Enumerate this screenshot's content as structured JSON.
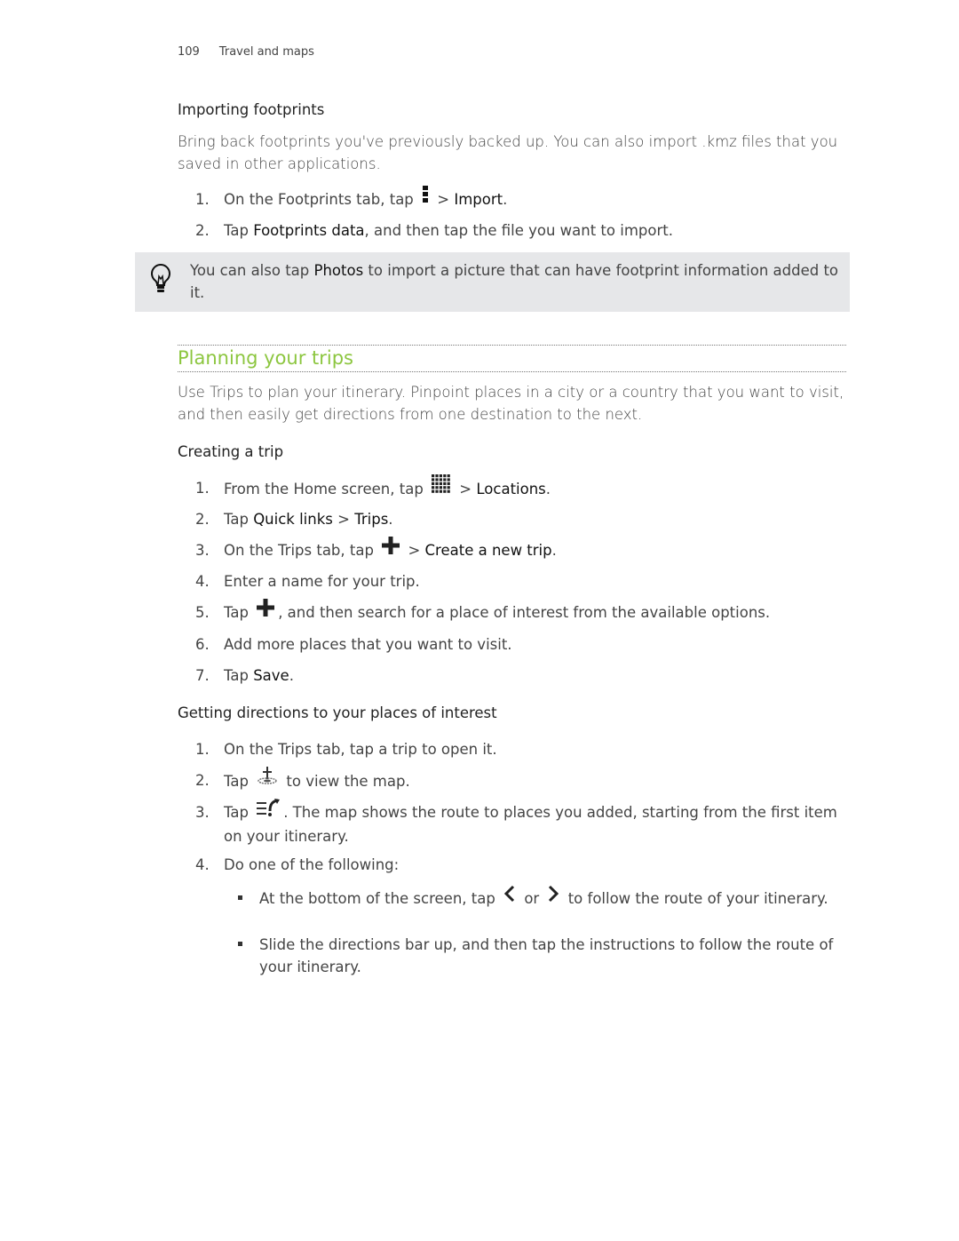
{
  "header": {
    "page_number": "109",
    "chapter": "Travel and maps"
  },
  "importing": {
    "title": "Importing footprints",
    "intro": "Bring back footprints you've previously backed up. You can also import .kmz files that you saved in other applications.",
    "steps": [
      [
        {
          "t": "On the Footprints tab, tap "
        },
        {
          "i": "menu-icon"
        },
        {
          "t": " > "
        },
        {
          "b": "Import"
        },
        {
          "t": "."
        }
      ],
      [
        {
          "t": "Tap "
        },
        {
          "b": "Footprints data"
        },
        {
          "t": ", and then tap the file you want to import."
        }
      ]
    ],
    "note": [
      {
        "t": "You can also tap "
      },
      {
        "b": "Photos"
      },
      {
        "t": " to import a picture that can have footprint information added to it."
      }
    ]
  },
  "planning": {
    "title": "Planning your trips",
    "intro": "Use Trips to plan your itinerary. Pinpoint places in a city or a country that you want to visit, and then easily get directions from one destination to the next."
  },
  "creating": {
    "title": "Creating a trip",
    "steps": [
      [
        {
          "t": "From the Home screen, tap "
        },
        {
          "i": "apps-grid-icon"
        },
        {
          "t": " > "
        },
        {
          "b": "Locations"
        },
        {
          "t": "."
        }
      ],
      [
        {
          "t": "Tap "
        },
        {
          "b": "Quick links"
        },
        {
          "t": " > "
        },
        {
          "b": "Trips"
        },
        {
          "t": "."
        }
      ],
      [
        {
          "t": "On the Trips tab, tap "
        },
        {
          "i": "plus-icon"
        },
        {
          "t": " > "
        },
        {
          "b": "Create a new trip"
        },
        {
          "t": "."
        }
      ],
      [
        {
          "t": "Enter a name for your trip."
        }
      ],
      [
        {
          "t": "Tap "
        },
        {
          "i": "plus-icon"
        },
        {
          "t": ", and then search for a place of interest from the available options."
        }
      ],
      [
        {
          "t": "Add more places that you want to visit."
        }
      ],
      [
        {
          "t": "Tap "
        },
        {
          "b": "Save"
        },
        {
          "t": "."
        }
      ]
    ]
  },
  "directions": {
    "title": "Getting directions to your places of interest",
    "steps": [
      [
        {
          "t": "On the Trips tab, tap a trip to open it."
        }
      ],
      [
        {
          "t": "Tap "
        },
        {
          "i": "map-pin-icon"
        },
        {
          "t": " to view the map."
        }
      ],
      [
        {
          "t": "Tap "
        },
        {
          "i": "route-icon"
        },
        {
          "t": ". The map shows the route to places you added, starting from the first item on your itinerary."
        }
      ],
      [
        {
          "t": "Do one of the following:"
        }
      ]
    ],
    "bullets": [
      [
        {
          "t": "At the bottom of the screen, tap "
        },
        {
          "i": "chevron-left-icon"
        },
        {
          "t": " or "
        },
        {
          "i": "chevron-right-icon"
        },
        {
          "t": " to follow the route of your itinerary."
        }
      ],
      [
        {
          "t": "Slide the directions bar up, and then tap the instructions to follow the route of your itinerary."
        }
      ]
    ]
  },
  "colors": {
    "heading_accent": "#8cc63f",
    "note_background": "#e6e7e9"
  }
}
